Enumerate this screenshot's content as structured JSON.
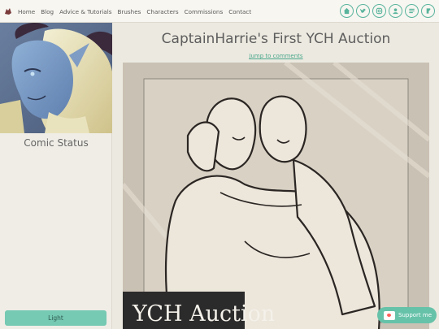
{
  "nav": {
    "links": [
      "Home",
      "Blog",
      "Advice & Tutorials",
      "Brushes",
      "Characters",
      "Commissions",
      "Contact"
    ],
    "social_icons": [
      "home-icon",
      "twitter-icon",
      "instagram-icon",
      "patreon-icon",
      "tumblr-icon",
      "deviantart-icon"
    ]
  },
  "sidebar": {
    "status_title": "Comic Status",
    "theme_button": "Light"
  },
  "main": {
    "title": "CaptainHarrie's First YCH Auction",
    "jump_link": "Jump to comments",
    "artwork_caption": "YCH Auction"
  },
  "support": {
    "label": "Support me"
  },
  "colors": {
    "accent": "#59b49c",
    "button": "#76c9b3",
    "background": "#ece9e0"
  }
}
